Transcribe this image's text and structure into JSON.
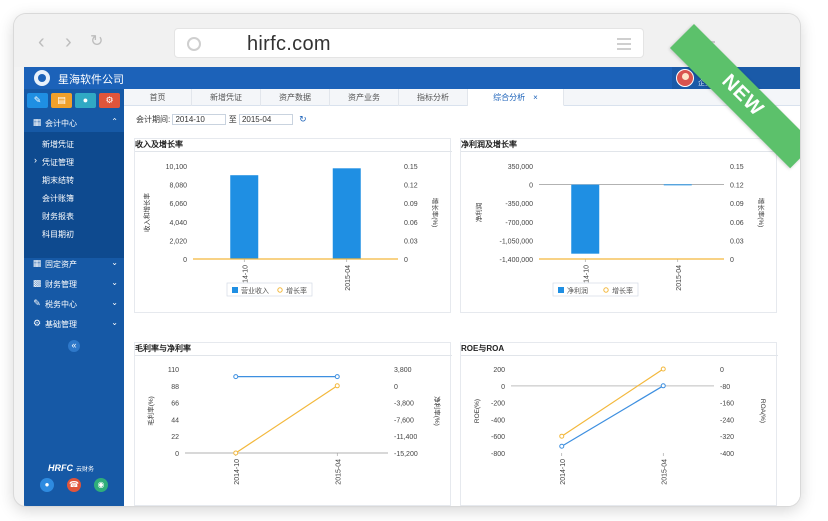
{
  "browser": {
    "url": "hirfc.com",
    "ribbon": "NEW"
  },
  "app": {
    "company": "星海软件公司",
    "user": {
      "name": "test",
      "role": "企业管理员"
    }
  },
  "sidebar": {
    "main": [
      {
        "label": "会计中心",
        "icon": "calendar-icon"
      },
      {
        "label": "固定资产",
        "icon": "building-icon"
      },
      {
        "label": "财务管理",
        "icon": "bar-chart-icon"
      },
      {
        "label": "税务中心",
        "icon": "edit-icon"
      },
      {
        "label": "基础管理",
        "icon": "gear-icon"
      }
    ],
    "sub": [
      "新增凭证",
      "凭证管理",
      "期末结转",
      "会计账簿",
      "财务报表",
      "科目期初"
    ],
    "brand": "HRFC",
    "brand_sub": "云财务"
  },
  "tabs": [
    "首页",
    "新增凭证",
    "资产数据",
    "资产业务",
    "指标分析",
    "综合分析"
  ],
  "period": {
    "label": "会计期间:",
    "from": "2014-10",
    "to_label": "至",
    "to": "2015-04"
  },
  "chart_data": [
    {
      "type": "bar",
      "title": "收入及增长率",
      "categories": [
        "2014-10",
        "2015-04"
      ],
      "ylabel": "收入和增长率",
      "y2label": "增长率(%)",
      "ylim": [
        0,
        10100
      ],
      "y_ticks": [
        "10,100",
        "8,080",
        "6,060",
        "4,040",
        "2,020",
        "0"
      ],
      "y2_ticks": [
        "0.15",
        "0.12",
        "0.09",
        "0.06",
        "0.03",
        "0"
      ],
      "series": [
        {
          "name": "营业收入",
          "kind": "bar",
          "values": [
            9100,
            9850
          ]
        },
        {
          "name": "增长率",
          "kind": "line",
          "values": [
            0,
            0
          ]
        }
      ],
      "colors": {
        "bar": "#1f8fe3",
        "line": "#f3b83c"
      },
      "legend": "bottom"
    },
    {
      "type": "bar",
      "title": "净利润及增长率",
      "categories": [
        "2014-10",
        "2015-04"
      ],
      "ylabel": "净利润",
      "y2label": "增长率(%)",
      "ylim": [
        -1400000,
        350000
      ],
      "y_ticks": [
        "350,000",
        "0",
        "-350,000",
        "-700,000",
        "-1,050,000",
        "-1,400,000"
      ],
      "y2_ticks": [
        "0.15",
        "0.12",
        "0.09",
        "0.06",
        "0.03",
        "0"
      ],
      "series": [
        {
          "name": "净利润",
          "kind": "bar",
          "values": [
            -1300000,
            5000
          ]
        },
        {
          "name": "增长率",
          "kind": "line",
          "values": [
            0,
            0
          ]
        }
      ],
      "colors": {
        "bar": "#1f8fe3",
        "line": "#f3b83c"
      },
      "legend": "bottom"
    },
    {
      "type": "line",
      "title": "毛利率与净利率",
      "categories": [
        "2014-10",
        "2015-04"
      ],
      "ylabel": "毛利率(%)",
      "y2label": "净利率(%)",
      "ylim": [
        0,
        110
      ],
      "y_ticks": [
        "110",
        "88",
        "66",
        "44",
        "22",
        "0"
      ],
      "y2_ticks": [
        "3,800",
        "0",
        "-3,800",
        "-7,600",
        "-11,400",
        "-15,200"
      ],
      "series": [
        {
          "name": "毛利率",
          "values": [
            100,
            100
          ]
        },
        {
          "name": "净利率",
          "values": [
            -15200,
            0
          ]
        }
      ],
      "colors": {
        "gross": "#3d8fe0",
        "net": "#f3b83c"
      }
    },
    {
      "type": "line",
      "title": "ROE与ROA",
      "categories": [
        "2014-10",
        "2015-04"
      ],
      "ylabel": "ROE(%)",
      "y2label": "ROA(%)",
      "ylim": [
        -800,
        200
      ],
      "y_ticks": [
        "200",
        "0",
        "-200",
        "-400",
        "-600",
        "-800"
      ],
      "y2_ticks": [
        "0",
        "-80",
        "-160",
        "-240",
        "-320",
        "-400"
      ],
      "series": [
        {
          "name": "ROE",
          "values": [
            -720,
            0
          ]
        },
        {
          "name": "ROA",
          "values": [
            -320,
            0
          ]
        }
      ],
      "colors": {
        "roe": "#3d8fe0",
        "roa": "#f3b83c"
      }
    }
  ]
}
